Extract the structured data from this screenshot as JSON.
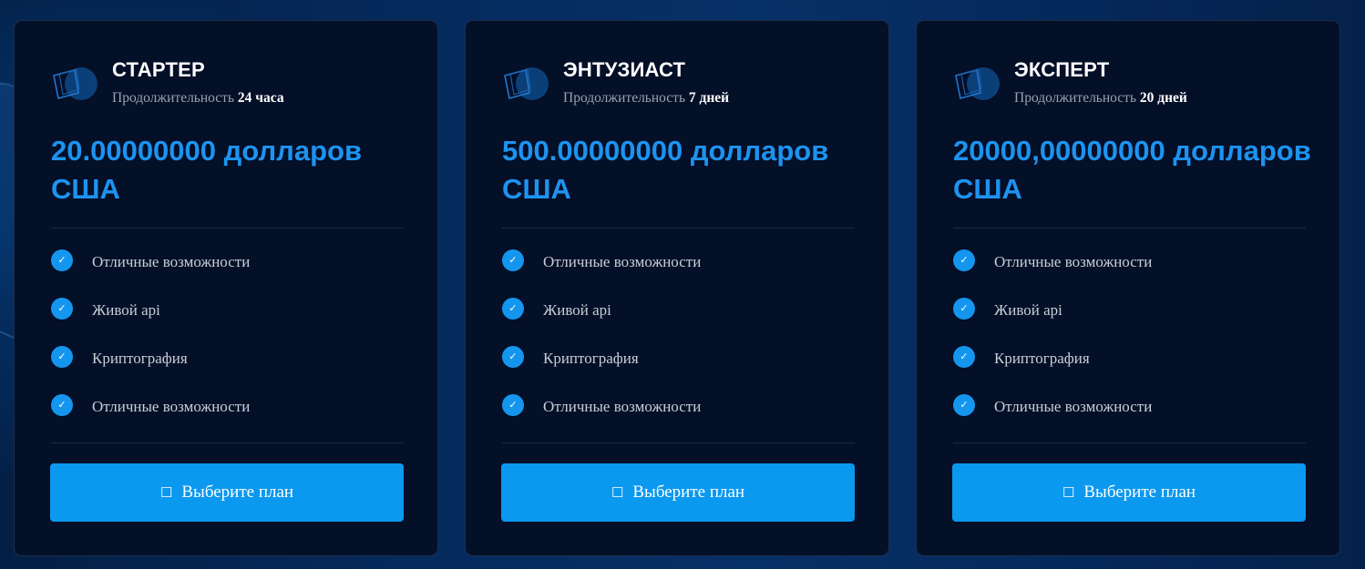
{
  "colors": {
    "background": "#052a5c",
    "card_background": "#040f28",
    "accent_blue": "#1d93ef",
    "button_blue": "#0b98ef",
    "title_white": "#ffffff",
    "muted_text": "#9aa3af"
  },
  "icons": {
    "plan_logo": "cube-logo-icon",
    "feature_marker": "check-circle-icon",
    "button_icon": "cart-icon"
  },
  "plans": [
    {
      "name": "СТАРТЕР",
      "duration_label": "Продолжительность",
      "duration_value": "24 часа",
      "price": "20.00000000 долларов США",
      "features": [
        "Отличные возможности",
        "Живой api",
        "Криптография",
        "Отличные возможности"
      ],
      "button_label": "Выберите план"
    },
    {
      "name": "ЭНТУЗИАСТ",
      "duration_label": "Продолжительность",
      "duration_value": "7 дней",
      "price": "500.00000000 долларов США",
      "features": [
        "Отличные возможности",
        "Живой api",
        "Криптография",
        "Отличные возможности"
      ],
      "button_label": "Выберите план"
    },
    {
      "name": "ЭКСПЕРТ",
      "duration_label": "Продолжительность",
      "duration_value": "20 дней",
      "price": "20000,00000000 долларов США",
      "features": [
        "Отличные возможности",
        "Живой api",
        "Криптография",
        "Отличные возможности"
      ],
      "button_label": "Выберите план"
    }
  ]
}
